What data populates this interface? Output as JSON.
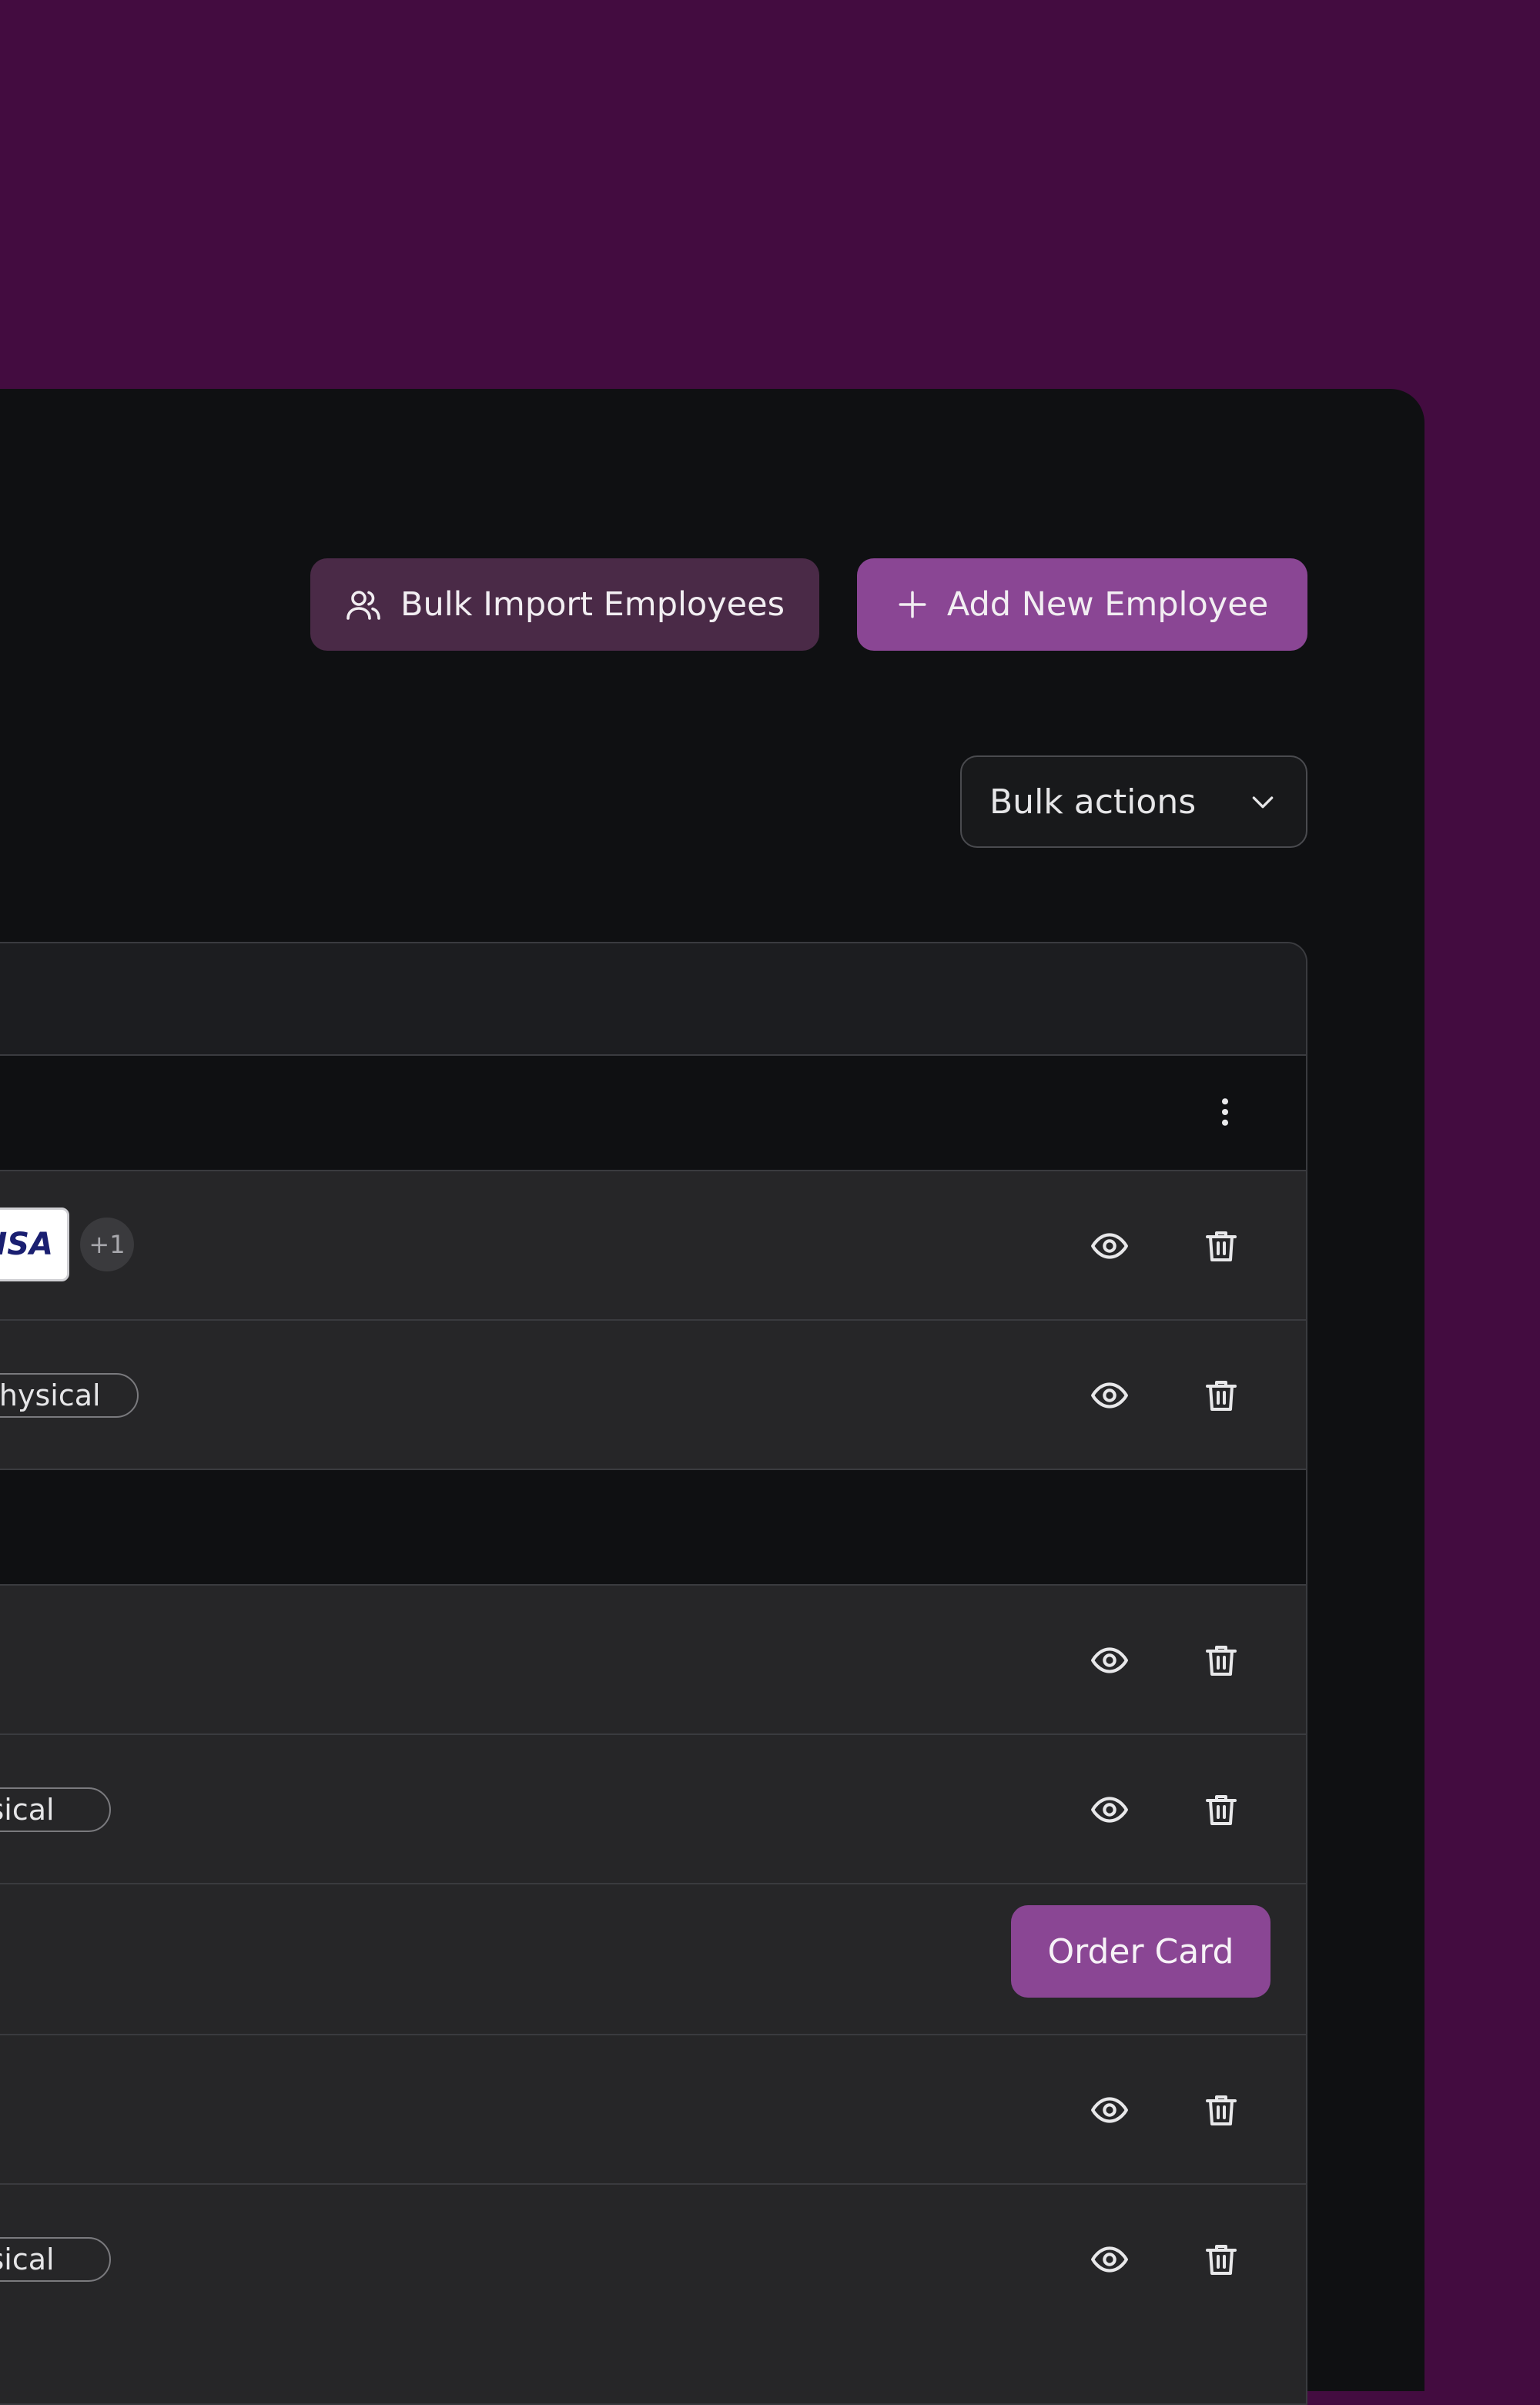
{
  "header": {
    "bulk_import_label": "Bulk Import Employees",
    "add_employee_label": "Add New Employee"
  },
  "toolbar": {
    "bulk_actions_label": "Bulk actions"
  },
  "rows": {
    "row1": {
      "card_brand": "VISA",
      "extra_cards": "+1"
    },
    "row2": {
      "card_type": "Physical"
    },
    "row4": {
      "card_type": "Physical"
    },
    "row5": {
      "order_card_label": "Order Card"
    },
    "row7": {
      "card_type": "Physical"
    }
  },
  "icons": [
    "users-icon",
    "plus-icon",
    "chevron-down-icon",
    "eye-icon",
    "trash-icon",
    "more-vertical-icon"
  ],
  "colors": {
    "background": "#430c40",
    "panel": "#0f1012",
    "accent": "#8a4694",
    "secondary_button": "#4a2a47"
  }
}
